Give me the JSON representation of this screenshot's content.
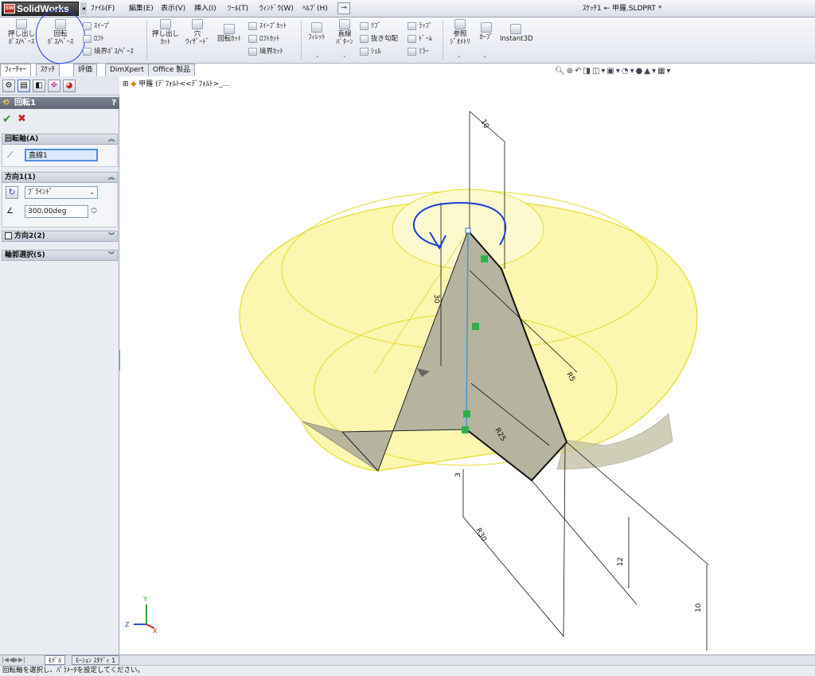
{
  "app": {
    "logo": "SolidWorks",
    "logo_mark": "SW",
    "arrow": "◂"
  },
  "menu": [
    {
      "label": "ﾌｧｲﾙ(F)"
    },
    {
      "label": "編集(E)"
    },
    {
      "label": "表示(V)"
    },
    {
      "label": "挿入(I)"
    },
    {
      "label": "ﾂｰﾙ(T)"
    },
    {
      "label": "ｳｨﾝﾄﾞｳ(W)"
    },
    {
      "label": "ﾍﾙﾌﾟ(H)"
    }
  ],
  "pin": "⊸",
  "window_title": "ｽｹｯﾁ1 ← 甲羅.SLDPRT *",
  "ribbon": {
    "extrude_boss": [
      "押し出し",
      "ﾎﾞｽ/ﾍﾞｰｽ"
    ],
    "revolve_boss": [
      "回転",
      "ﾎﾞｽ/ﾍﾞｰｽ"
    ],
    "sweep": "ｽｲｰﾌﾟ",
    "loft": "ﾛﾌﾄ",
    "boundary_boss": "境界ﾎﾞｽ/ﾍﾞｰｽ",
    "extrude_cut": [
      "押し出し",
      "ｶｯﾄ"
    ],
    "hole_wizard": [
      "穴",
      "ｳｨｻﾞｰﾄﾞ"
    ],
    "revolve_cut": "回転ｶｯﾄ",
    "swept_cut": "ｽｲｰﾌﾟｶｯﾄ",
    "lofted_cut": "ﾛﾌﾄｶｯﾄ",
    "boundary_cut": "境界ｶｯﾄ",
    "fillet": "ﾌｨﾚｯﾄ",
    "linear_pattern": [
      "直線",
      "ﾊﾟﾀｰﾝ"
    ],
    "rib": "ﾘﾌﾞ",
    "draft": "抜き勾配",
    "shell": "ｼｪﾙ",
    "wrap": "ﾗｯﾌﾟ",
    "dome": "ﾄﾞｰﾑ",
    "mirror": "ﾐﾗｰ",
    "ref_geometry": [
      "参照",
      "ｼﾞｵﾒﾄﾘ"
    ],
    "curves": "ｶｰﾌﾞ",
    "instant3d": "Instant3D"
  },
  "feature_tabs": [
    {
      "label": "ﾌｨｰﾁｬｰ"
    },
    {
      "label": "ｽｹｯﾁ"
    },
    {
      "label": "評価"
    },
    {
      "label": "DimXpert"
    },
    {
      "label": "Office 製品"
    }
  ],
  "property_manager": {
    "title": "回転1",
    "help": "?",
    "ok": "✔",
    "cancel": "✖",
    "axis_group": {
      "label": "回転軸(A)",
      "value": "直線1"
    },
    "direction1": {
      "label": "方向1(1)",
      "type": "ﾌﾞﾗｲﾝﾄﾞ",
      "angle": "300.00deg"
    },
    "direction2": {
      "label": "方向2(2)"
    },
    "contours": {
      "label": "輪郭選択(S)"
    }
  },
  "tree": {
    "root": "甲羅 (ﾃﾞﾌｫﾙﾄ<<ﾃﾞﾌｫﾙﾄ>_..."
  },
  "dimensions": [
    "10",
    "30",
    "R5",
    "R25",
    "R30",
    "12",
    "10",
    "3"
  ],
  "triad": {
    "x": "X",
    "y": "Y",
    "z": "Z"
  },
  "status_tabs": [
    {
      "label": "ﾓﾃﾞﾙ"
    },
    {
      "label": "ﾓｰｼｮﾝ ｽﾀﾃﾞｨ 1"
    }
  ],
  "statusbar": "回転軸を選択し、ﾊﾟﾗﾒｰﾀを設定してください。",
  "colors": {
    "accent_blue": "#1a3fd8",
    "solid_yellow": "#fbf6b0",
    "profile_gray": "#b6b49e"
  }
}
